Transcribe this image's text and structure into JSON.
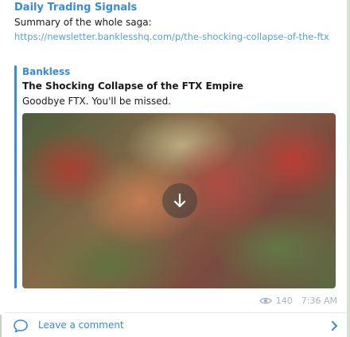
{
  "message": {
    "channel_name": "Daily Trading Signals",
    "text": "Summary of the whole saga:",
    "link": "https://newsletter.banklesshq.com/p/the-shocking-collapse-of-the-ftx"
  },
  "preview": {
    "site_name": "Bankless",
    "title": "The Shocking Collapse of the FTX Empire",
    "description": "Goodbye FTX. You'll be missed.",
    "image_icon": "download-arrow-icon"
  },
  "meta": {
    "views": "140",
    "time": "7:36 AM",
    "views_icon": "eye-icon"
  },
  "comments": {
    "label": "Leave a comment",
    "icon": "comment-bubble-icon",
    "chevron_icon": "chevron-right-icon"
  },
  "colors": {
    "accent": "#3a8ad6",
    "link": "#5aa0d8",
    "meta": "#a9b3bd",
    "text": "#1a1a1a"
  }
}
